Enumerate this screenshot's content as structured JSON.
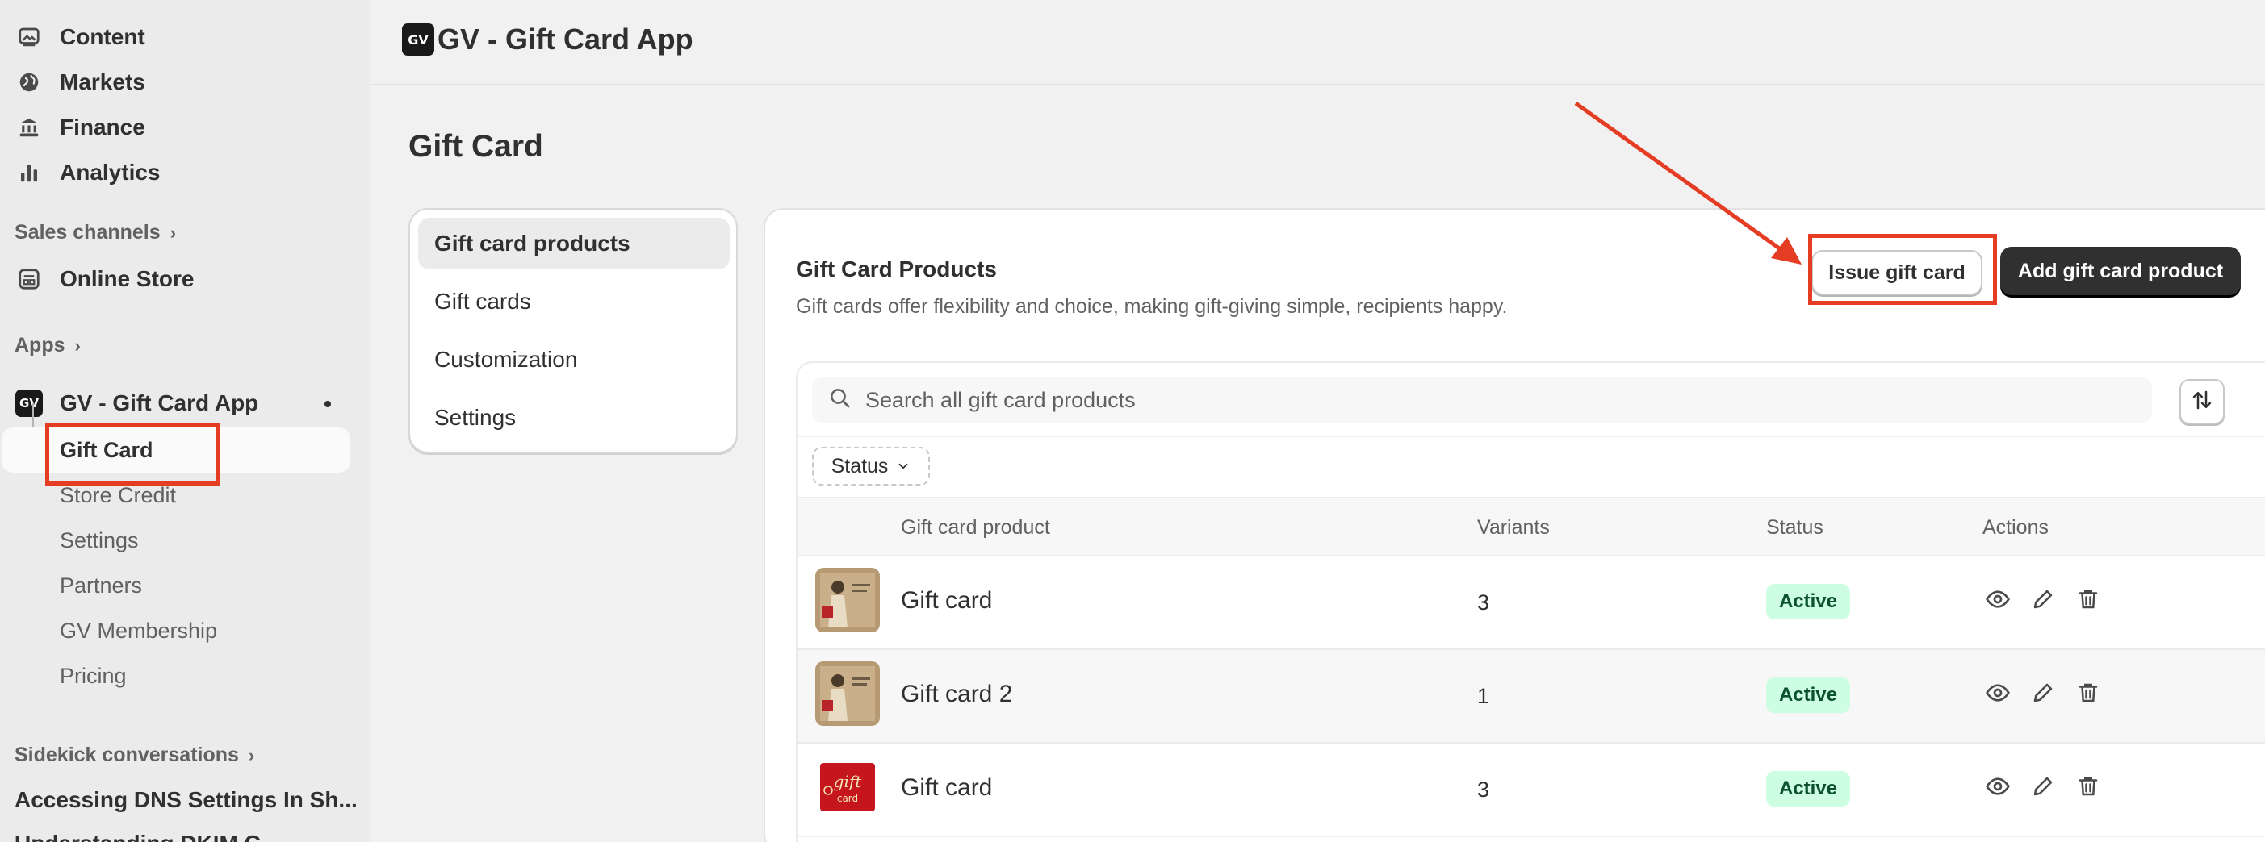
{
  "sidebar": {
    "nav": [
      {
        "label": "Content",
        "icon": "image-icon"
      },
      {
        "label": "Markets",
        "icon": "globe-icon"
      },
      {
        "label": "Finance",
        "icon": "bank-icon"
      },
      {
        "label": "Analytics",
        "icon": "bar-chart-icon"
      }
    ],
    "sales_channels_label": "Sales channels",
    "online_store_label": "Online Store",
    "apps_label": "Apps",
    "app_name": "GV - Gift Card App",
    "app_logo_text": "GV",
    "app_subitems": [
      "Gift Card",
      "Store Credit",
      "Settings",
      "Partners",
      "GV Membership",
      "Pricing"
    ],
    "sidekick_label": "Sidekick conversations",
    "conversations": [
      "Accessing DNS Settings In Sh...",
      "Understanding DKIM C..."
    ]
  },
  "topbar": {
    "title": "GV - Gift Card App",
    "logo_text": "GV"
  },
  "page": {
    "title": "Gift Card"
  },
  "menu": {
    "items": [
      "Gift card products",
      "Gift cards",
      "Customization",
      "Settings"
    ]
  },
  "card": {
    "title": "Gift Card Products",
    "subtitle": "Gift cards offer flexibility and choice, making gift-giving simple, recipients happy.",
    "issue_button": "Issue gift card",
    "add_button": "Add gift card product",
    "search_placeholder": "Search all gift card products",
    "status_filter": "Status",
    "columns": [
      "Gift card product",
      "Variants",
      "Status",
      "Actions"
    ],
    "rows": [
      {
        "name": "Gift card",
        "variants": "3",
        "status": "Active"
      },
      {
        "name": "Gift card 2",
        "variants": "1",
        "status": "Active"
      },
      {
        "name": "Gift card",
        "variants": "3",
        "status": "Active"
      }
    ]
  },
  "colors": {
    "annotation": "#e43d24",
    "badge_bg": "#cdfee1",
    "primary_btn": "#303030"
  }
}
